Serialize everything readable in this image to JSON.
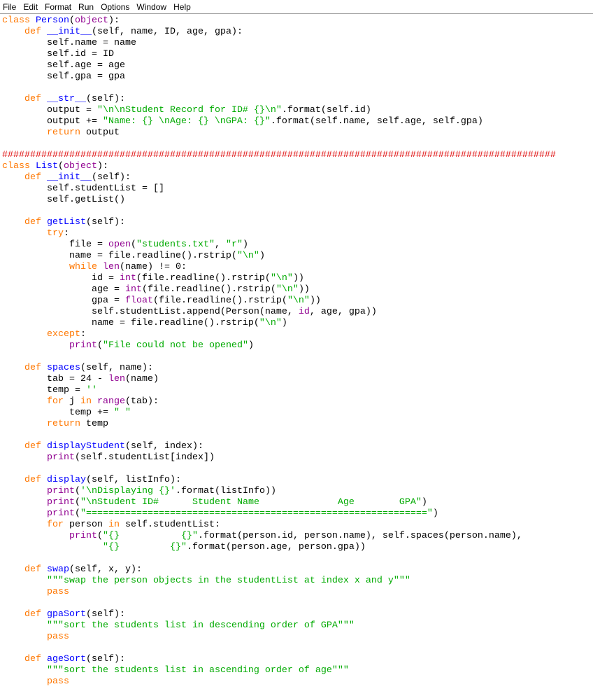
{
  "window": {
    "menu": [
      "File",
      "Edit",
      "Format",
      "Run",
      "Options",
      "Window",
      "Help"
    ]
  },
  "colors": {
    "keyword": "#ff7700",
    "definition": "#0000ff",
    "builtin": "#900090",
    "string": "#00aa00",
    "comment": "#dd0000",
    "plain": "#000000"
  },
  "editor": {
    "language": "python",
    "lines": [
      [
        [
          "kw",
          "class"
        ],
        [
          "p",
          " "
        ],
        [
          "def",
          "Person"
        ],
        [
          "p",
          "("
        ],
        [
          "bi",
          "object"
        ],
        [
          "p",
          "):"
        ]
      ],
      [
        [
          "p",
          "    "
        ],
        [
          "kw",
          "def"
        ],
        [
          "p",
          " "
        ],
        [
          "def",
          "__init__"
        ],
        [
          "p",
          "(self, name, ID, age, gpa):"
        ]
      ],
      [
        [
          "p",
          "        self.name = name"
        ]
      ],
      [
        [
          "p",
          "        self.id = ID"
        ]
      ],
      [
        [
          "p",
          "        self.age = age"
        ]
      ],
      [
        [
          "p",
          "        self.gpa = gpa"
        ]
      ],
      [],
      [
        [
          "p",
          "    "
        ],
        [
          "kw",
          "def"
        ],
        [
          "p",
          " "
        ],
        [
          "def",
          "__str__"
        ],
        [
          "p",
          "(self):"
        ]
      ],
      [
        [
          "p",
          "        output = "
        ],
        [
          "str",
          "\"\\n\\nStudent Record for ID# {}\\n\""
        ],
        [
          "p",
          ".format(self.id)"
        ]
      ],
      [
        [
          "p",
          "        output += "
        ],
        [
          "str",
          "\"Name: {} \\nAge: {} \\nGPA: {}\""
        ],
        [
          "p",
          ".format(self.name, self.age, self.gpa)"
        ]
      ],
      [
        [
          "p",
          "        "
        ],
        [
          "kw",
          "return"
        ],
        [
          "p",
          " output"
        ]
      ],
      [],
      [
        [
          "cmt",
          "###################################################################################################"
        ]
      ],
      [
        [
          "kw",
          "class"
        ],
        [
          "p",
          " "
        ],
        [
          "def",
          "List"
        ],
        [
          "p",
          "("
        ],
        [
          "bi",
          "object"
        ],
        [
          "p",
          "):"
        ]
      ],
      [
        [
          "p",
          "    "
        ],
        [
          "kw",
          "def"
        ],
        [
          "p",
          " "
        ],
        [
          "def",
          "__init__"
        ],
        [
          "p",
          "(self):"
        ]
      ],
      [
        [
          "p",
          "        self.studentList = []"
        ]
      ],
      [
        [
          "p",
          "        self.getList()"
        ]
      ],
      [],
      [
        [
          "p",
          "    "
        ],
        [
          "kw",
          "def"
        ],
        [
          "p",
          " "
        ],
        [
          "def",
          "getList"
        ],
        [
          "p",
          "(self):"
        ]
      ],
      [
        [
          "p",
          "        "
        ],
        [
          "kw",
          "try"
        ],
        [
          "p",
          ":"
        ]
      ],
      [
        [
          "p",
          "            file = "
        ],
        [
          "bi",
          "open"
        ],
        [
          "p",
          "("
        ],
        [
          "str",
          "\"students.txt\""
        ],
        [
          "p",
          ", "
        ],
        [
          "str",
          "\"r\""
        ],
        [
          "p",
          ")"
        ]
      ],
      [
        [
          "p",
          "            name = file.readline().rstrip("
        ],
        [
          "str",
          "\"\\n\""
        ],
        [
          "p",
          ")"
        ]
      ],
      [
        [
          "p",
          "            "
        ],
        [
          "kw",
          "while"
        ],
        [
          "p",
          " "
        ],
        [
          "bi",
          "len"
        ],
        [
          "p",
          "(name) != 0:"
        ]
      ],
      [
        [
          "p",
          "                id = "
        ],
        [
          "bi",
          "int"
        ],
        [
          "p",
          "(file.readline().rstrip("
        ],
        [
          "str",
          "\"\\n\""
        ],
        [
          "p",
          "))"
        ]
      ],
      [
        [
          "p",
          "                age = "
        ],
        [
          "bi",
          "int"
        ],
        [
          "p",
          "(file.readline().rstrip("
        ],
        [
          "str",
          "\"\\n\""
        ],
        [
          "p",
          "))"
        ]
      ],
      [
        [
          "p",
          "                gpa = "
        ],
        [
          "bi",
          "float"
        ],
        [
          "p",
          "(file.readline().rstrip("
        ],
        [
          "str",
          "\"\\n\""
        ],
        [
          "p",
          "))"
        ]
      ],
      [
        [
          "p",
          "                self.studentList.append(Person(name, "
        ],
        [
          "bi",
          "id"
        ],
        [
          "p",
          ", age, gpa))"
        ]
      ],
      [
        [
          "p",
          "                name = file.readline().rstrip("
        ],
        [
          "str",
          "\"\\n\""
        ],
        [
          "p",
          ")"
        ]
      ],
      [
        [
          "p",
          "        "
        ],
        [
          "kw",
          "except"
        ],
        [
          "p",
          ":"
        ]
      ],
      [
        [
          "p",
          "            "
        ],
        [
          "bi",
          "print"
        ],
        [
          "p",
          "("
        ],
        [
          "str",
          "\"File could not be opened\""
        ],
        [
          "p",
          ")"
        ]
      ],
      [],
      [
        [
          "p",
          "    "
        ],
        [
          "kw",
          "def"
        ],
        [
          "p",
          " "
        ],
        [
          "def",
          "spaces"
        ],
        [
          "p",
          "(self, name):"
        ]
      ],
      [
        [
          "p",
          "        tab = 24 - "
        ],
        [
          "bi",
          "len"
        ],
        [
          "p",
          "(name)"
        ]
      ],
      [
        [
          "p",
          "        temp = "
        ],
        [
          "str",
          "''"
        ]
      ],
      [
        [
          "p",
          "        "
        ],
        [
          "kw",
          "for"
        ],
        [
          "p",
          " j "
        ],
        [
          "kw",
          "in"
        ],
        [
          "p",
          " "
        ],
        [
          "bi",
          "range"
        ],
        [
          "p",
          "(tab):"
        ]
      ],
      [
        [
          "p",
          "            temp += "
        ],
        [
          "str",
          "\" \""
        ]
      ],
      [
        [
          "p",
          "        "
        ],
        [
          "kw",
          "return"
        ],
        [
          "p",
          " temp"
        ]
      ],
      [],
      [
        [
          "p",
          "    "
        ],
        [
          "kw",
          "def"
        ],
        [
          "p",
          " "
        ],
        [
          "def",
          "displayStudent"
        ],
        [
          "p",
          "(self, index):"
        ]
      ],
      [
        [
          "p",
          "        "
        ],
        [
          "bi",
          "print"
        ],
        [
          "p",
          "(self.studentList[index])"
        ]
      ],
      [],
      [
        [
          "p",
          "    "
        ],
        [
          "kw",
          "def"
        ],
        [
          "p",
          " "
        ],
        [
          "def",
          "display"
        ],
        [
          "p",
          "(self, listInfo):"
        ]
      ],
      [
        [
          "p",
          "        "
        ],
        [
          "bi",
          "print"
        ],
        [
          "p",
          "("
        ],
        [
          "str",
          "'\\nDisplaying {}'"
        ],
        [
          "p",
          ".format(listInfo))"
        ]
      ],
      [
        [
          "p",
          "        "
        ],
        [
          "bi",
          "print"
        ],
        [
          "p",
          "("
        ],
        [
          "str",
          "\"\\nStudent ID#      Student Name              Age        GPA\""
        ],
        [
          "p",
          ")"
        ]
      ],
      [
        [
          "p",
          "        "
        ],
        [
          "bi",
          "print"
        ],
        [
          "p",
          "("
        ],
        [
          "str",
          "\"=============================================================\""
        ],
        [
          "p",
          ")"
        ]
      ],
      [
        [
          "p",
          "        "
        ],
        [
          "kw",
          "for"
        ],
        [
          "p",
          " person "
        ],
        [
          "kw",
          "in"
        ],
        [
          "p",
          " self.studentList:"
        ]
      ],
      [
        [
          "p",
          "            "
        ],
        [
          "bi",
          "print"
        ],
        [
          "p",
          "("
        ],
        [
          "str",
          "\"{}           {}\""
        ],
        [
          "p",
          ".format(person.id, person.name), self.spaces(person.name),"
        ]
      ],
      [
        [
          "p",
          "                  "
        ],
        [
          "str",
          "\"{}         {}\""
        ],
        [
          "p",
          ".format(person.age, person.gpa))"
        ]
      ],
      [],
      [
        [
          "p",
          "    "
        ],
        [
          "kw",
          "def"
        ],
        [
          "p",
          " "
        ],
        [
          "def",
          "swap"
        ],
        [
          "p",
          "(self, x, y):"
        ]
      ],
      [
        [
          "p",
          "        "
        ],
        [
          "str",
          "\"\"\"swap the person objects in the studentList at index x and y\"\"\""
        ]
      ],
      [
        [
          "p",
          "        "
        ],
        [
          "kw",
          "pass"
        ]
      ],
      [],
      [
        [
          "p",
          "    "
        ],
        [
          "kw",
          "def"
        ],
        [
          "p",
          " "
        ],
        [
          "def",
          "gpaSort"
        ],
        [
          "p",
          "(self):"
        ]
      ],
      [
        [
          "p",
          "        "
        ],
        [
          "str",
          "\"\"\"sort the students list in descending order of GPA\"\"\""
        ]
      ],
      [
        [
          "p",
          "        "
        ],
        [
          "kw",
          "pass"
        ]
      ],
      [],
      [
        [
          "p",
          "    "
        ],
        [
          "kw",
          "def"
        ],
        [
          "p",
          " "
        ],
        [
          "def",
          "ageSort"
        ],
        [
          "p",
          "(self):"
        ]
      ],
      [
        [
          "p",
          "        "
        ],
        [
          "str",
          "\"\"\"sort the students list in ascending order of age\"\"\""
        ]
      ],
      [
        [
          "p",
          "        "
        ],
        [
          "kw",
          "pass"
        ]
      ]
    ]
  }
}
